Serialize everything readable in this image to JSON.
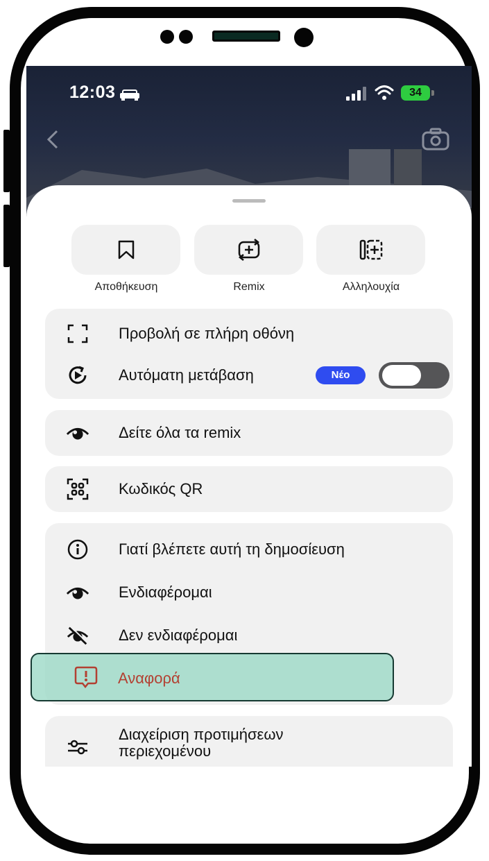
{
  "status_bar": {
    "time": "12:03",
    "battery": "34"
  },
  "actions": [
    {
      "label": "Αποθήκευση",
      "icon": "bookmark-icon"
    },
    {
      "label": "Remix",
      "icon": "remix-icon"
    },
    {
      "label": "Αλληλουχία",
      "icon": "sequence-icon"
    }
  ],
  "menu": {
    "fullscreen": "Προβολή σε πλήρη οθόνη",
    "autoplay": "Αυτόματη μετάβαση",
    "new_badge": "Νέο",
    "autoplay_enabled": false,
    "see_remixes": "Δείτε όλα τα remix",
    "qr_code": "Κωδικός QR",
    "why_seeing": "Γιατί βλέπετε αυτή τη δημοσίευση",
    "interested": "Ενδιαφέρομαι",
    "not_interested": "Δεν ενδιαφέρομαι",
    "report": "Αναφορά",
    "manage_prefs_line1": "Διαχείριση προτιμήσεων",
    "manage_prefs_line2": "περιεχομένου"
  },
  "colors": {
    "badge": "#2f4cf0",
    "report_text": "#b34032",
    "highlight": "#96d7c3"
  }
}
